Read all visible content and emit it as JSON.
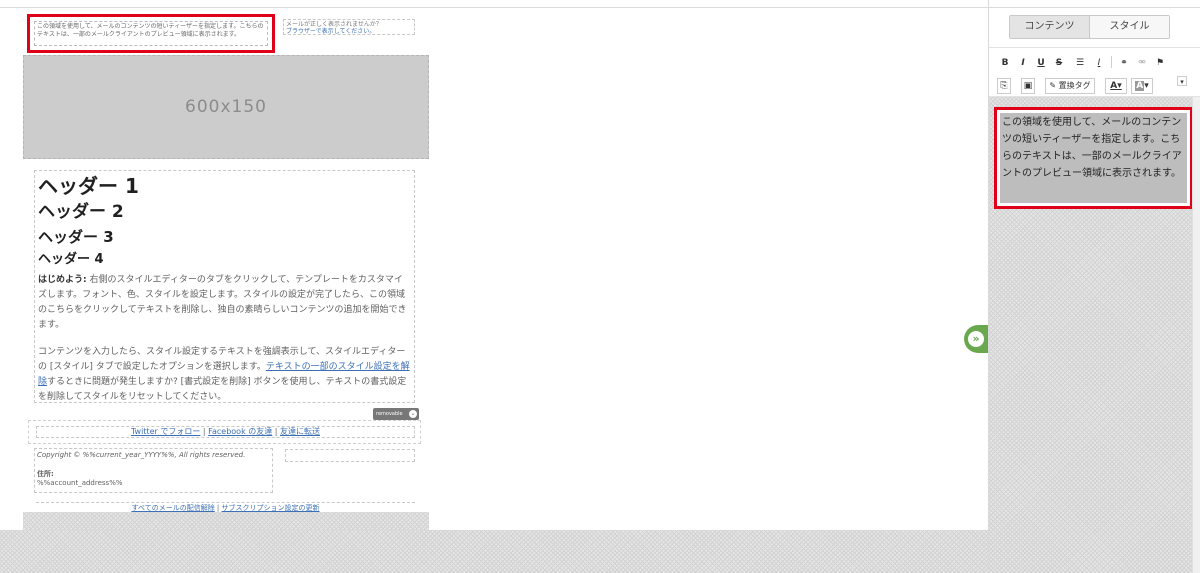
{
  "email": {
    "preheader_text": "この領域を使用して、メールのコンテンツの短いティーザーを指定します。こちらのテキストは、一部のメールクライアントのプレビュー領域に表示されます。",
    "view_browser_question": "メールが正しく表示されませんか？",
    "view_browser_link": "ブラウザーで表示してください。",
    "hero_placeholder": "600x150",
    "heading1": "ヘッダー 1",
    "heading2": "ヘッダー 2",
    "heading3": "ヘッダー 3",
    "heading4": "ヘッダー 4",
    "para1_lead": "はじめよう:",
    "para1_text": " 右側のスタイルエディターのタブをクリックして、テンプレートをカスタマイズします。フォント、色、スタイルを設定します。スタイルの設定が完了したら、この領域のこちらをクリックしてテキストを削除し、独自の素晴らしいコンテンツの追加を開始できます。",
    "para2_text_a": "コンテンツを入力したら、スタイル設定するテキストを強調表示して、スタイルエディターの [スタイル] タブで設定したオプションを選択します。",
    "para2_link": "テキストの一部のスタイル設定を解除",
    "para2_text_b": "するときに問題が発生しますか? [書式設定を削除] ボタンを使用し、テキストの書式設定を削除してスタイルをリセットしてください。",
    "removable_label": "removable",
    "social": {
      "twitter": "Twitter でフォロー",
      "sep1": " | ",
      "facebook": "Facebook の友達",
      "sep2": " | ",
      "forward": "友達に転送"
    },
    "footer": {
      "copyright": "Copyright © %%current_year_YYYY%%, All rights reserved.",
      "address_label": "住所:",
      "address_value": "%%account_address%%"
    },
    "unsubscribe": {
      "unsub_link": "すべてのメールの配信解除",
      "sep": " | ",
      "update_link": "サブスクリプション設定の更新"
    }
  },
  "panel": {
    "tabs": [
      {
        "label": "コンテンツ",
        "active": true
      },
      {
        "label": "スタイル",
        "active": false
      }
    ],
    "toolbar": {
      "bold": "B",
      "italic": "I",
      "underline": "U",
      "strike": "S",
      "clear": "I",
      "merge_tag": "置換タグ",
      "font_color": "A",
      "bg_color": "A"
    },
    "editor_text": "この領域を使用して、メールのコンテンツの短いティーザーを指定します。こちらのテキストは、一部のメールクライアントのプレビュー領域に表示されます。"
  },
  "colors": {
    "highlight_border": "#e0001a",
    "link": "#3b6fb6",
    "collapse_button": "#6aa84f"
  }
}
